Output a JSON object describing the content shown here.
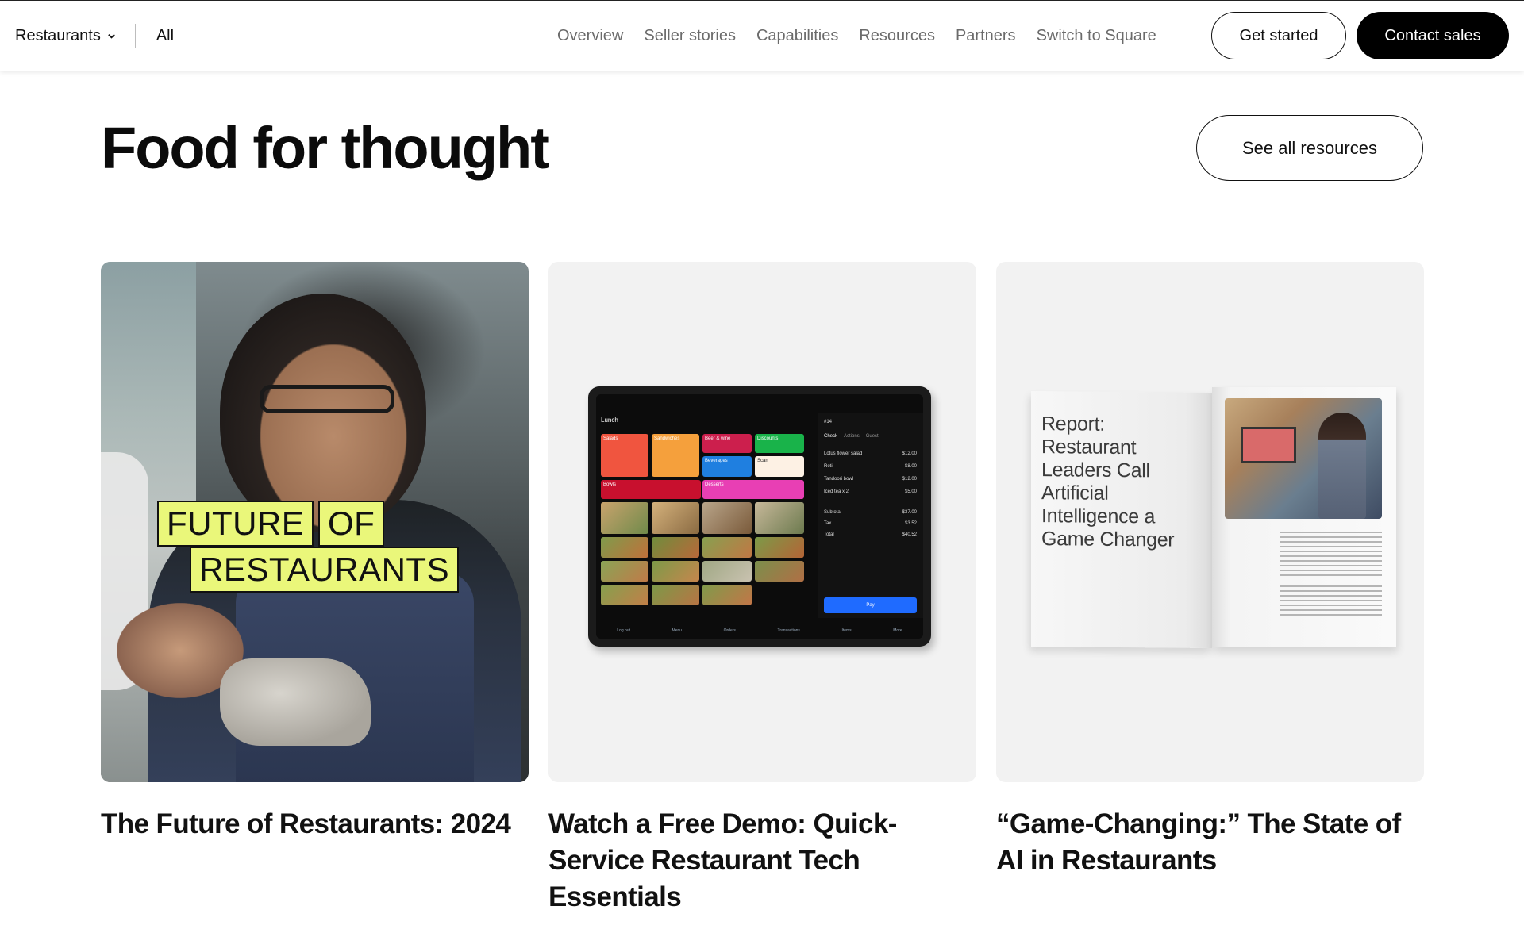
{
  "nav": {
    "segment_label": "Restaurants",
    "all_label": "All",
    "links": [
      "Overview",
      "Seller stories",
      "Capabilities",
      "Resources",
      "Partners",
      "Switch to Square"
    ],
    "get_started": "Get started",
    "contact_sales": "Contact sales"
  },
  "section": {
    "title": "Food for thought",
    "see_all": "See all resources"
  },
  "cards": [
    {
      "title": "The Future of Restaurants: 2024",
      "tags": [
        "FUTURE",
        "OF",
        "RESTAURANTS"
      ]
    },
    {
      "title": "Watch a Free Demo: Quick-Service Restaurant Tech Essentials",
      "tablet": {
        "menu_name": "Lunch",
        "order_number": "#14",
        "tabs": [
          "Check",
          "Actions",
          "Guest"
        ],
        "categories": [
          "Salads",
          "Sandwiches",
          "Beer & wine",
          "Discounts",
          "Beverages",
          "Scan",
          "Bowls",
          "Desserts"
        ],
        "lines": [
          {
            "item": "Lotus flower salad",
            "price": "$12.00"
          },
          {
            "item": "Roti",
            "price": "$8.00"
          },
          {
            "item": "Tandoori bowl",
            "price": "$12.00"
          },
          {
            "item": "Iced tea x 2",
            "price": "$5.00"
          }
        ],
        "subtotal_label": "Subtotal",
        "subtotal": "$37.00",
        "tax_label": "Tax",
        "tax": "$3.52",
        "total_label": "Total",
        "total": "$40.52",
        "pay": "Pay",
        "bottom": [
          "Log out",
          "Menu",
          "Orders",
          "Transactions",
          "Items",
          "More"
        ]
      }
    },
    {
      "title": "“Game-Changing:” The State of AI in Restaurants",
      "report_title": "Report: Restaurant Leaders Call Artificial Intelligence a Game Changer"
    }
  ],
  "colors": {
    "tag_yellow": "#eaf77a",
    "pay_blue": "#1f6bff",
    "tile_colors": [
      "#f0553f",
      "#f5a03c",
      "#cc1f4d",
      "#19b34a",
      "#1f7fe0",
      "#fdf1e4",
      "#c8102e",
      "#e83fb4"
    ]
  }
}
